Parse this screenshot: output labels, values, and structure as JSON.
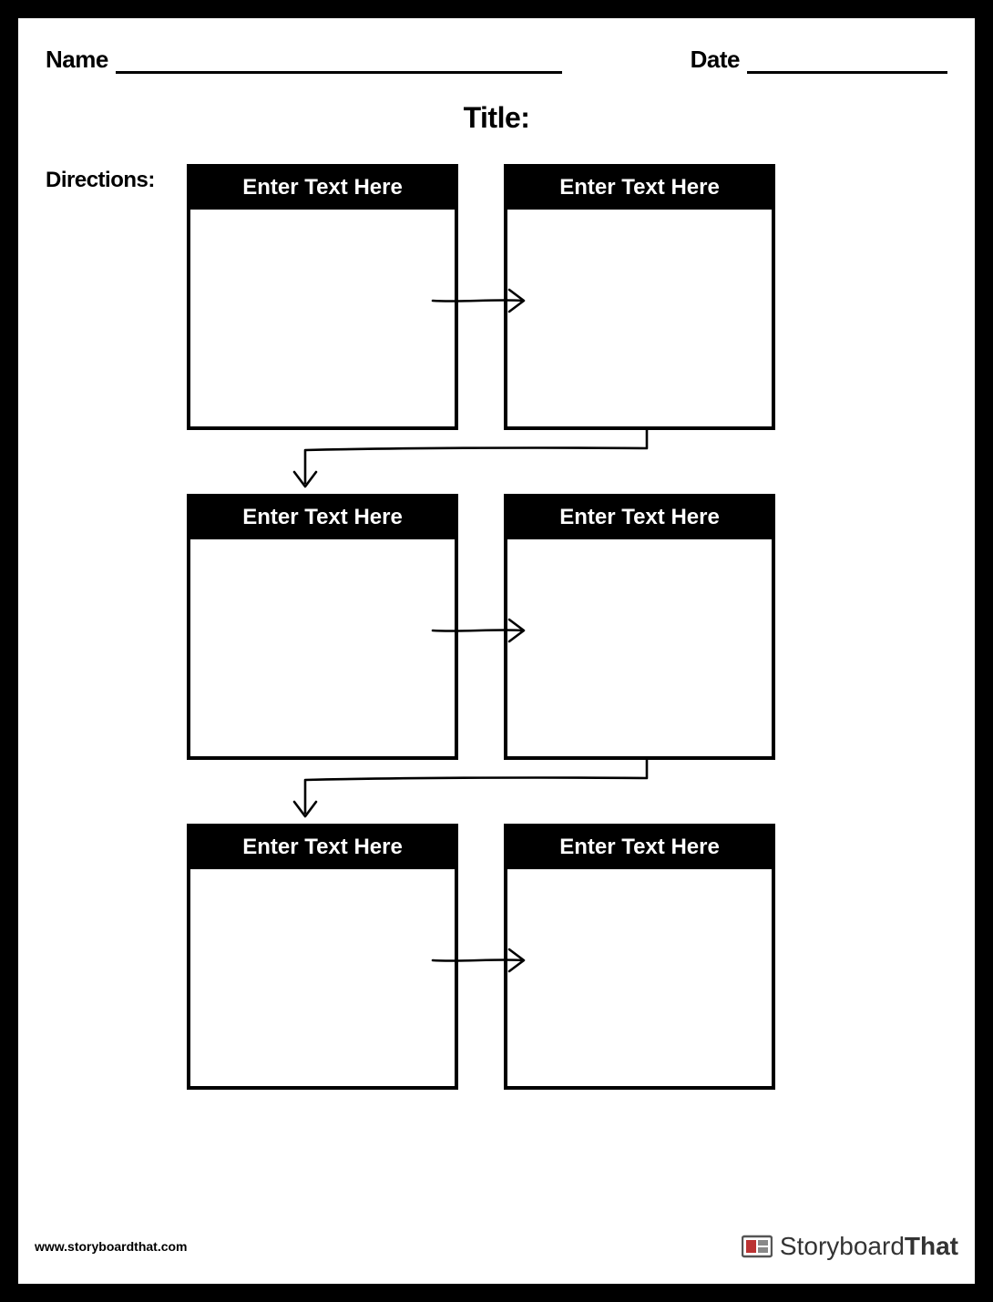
{
  "header": {
    "name_label": "Name",
    "date_label": "Date"
  },
  "title_label": "Title:",
  "directions_label": "Directions:",
  "cells": [
    {
      "header": "Enter Text Here"
    },
    {
      "header": "Enter Text Here"
    },
    {
      "header": "Enter Text Here"
    },
    {
      "header": "Enter Text Here"
    },
    {
      "header": "Enter Text Here"
    },
    {
      "header": "Enter Text Here"
    }
  ],
  "footer": {
    "url": "www.storyboardthat.com",
    "brand_part1": "Storyboard",
    "brand_part2": "That"
  }
}
